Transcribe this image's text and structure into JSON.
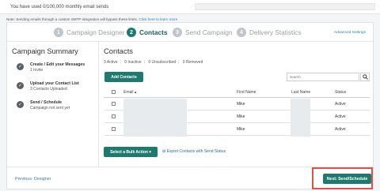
{
  "usage": {
    "text": "You have used 0/100,000 monthly email sends"
  },
  "note": {
    "text": "Note: Sending emails through a custom SMTP integration will bypass these limits.",
    "link": "Click here to learn more"
  },
  "steps": [
    {
      "num": "1",
      "label": "Campaign Designer",
      "active": false
    },
    {
      "num": "2",
      "label": "Contacts",
      "active": true
    },
    {
      "num": "3",
      "label": "Send Campaign",
      "active": false
    },
    {
      "num": "4",
      "label": "Delivery Statistics",
      "active": false
    }
  ],
  "advanced_settings": "Advanced Settings",
  "summary": {
    "title": "Campaign Summary",
    "items": [
      {
        "title": "Create / Edit your Messages",
        "subtitle": "1 Invite"
      },
      {
        "title": "Upload your Contact List",
        "subtitle": "3 Contacts Uploaded"
      },
      {
        "title": "Send / Schedule",
        "subtitle": "Campaign not sent yet"
      }
    ]
  },
  "contacts": {
    "title": "Contacts",
    "filters": {
      "active": "3 Active",
      "inactive": "0 Inactive",
      "unsubscribed": "0 Unsubscribed",
      "removed": "0 Removed"
    },
    "add_button": "Add Contacts",
    "search_placeholder": "search",
    "table": {
      "columns": {
        "email": "Email ▴",
        "first_name": "First Name",
        "last_name": "Last Name",
        "status": "Status"
      },
      "rows": [
        {
          "first_name": "Mike",
          "status": "Active"
        },
        {
          "first_name": "Mike",
          "status": "Active"
        },
        {
          "first_name": "Mike",
          "status": "Active"
        }
      ]
    },
    "bulk_action": "Select a Bulk Action ▾",
    "export_link": "Export Contacts with Send Status"
  },
  "footer": {
    "previous": "Previous: Designer",
    "next": "Next: Send/Schedule"
  },
  "colors": {
    "accent": "#1f7a6e",
    "highlight": "#d9544f",
    "link": "#2a7fb8"
  }
}
